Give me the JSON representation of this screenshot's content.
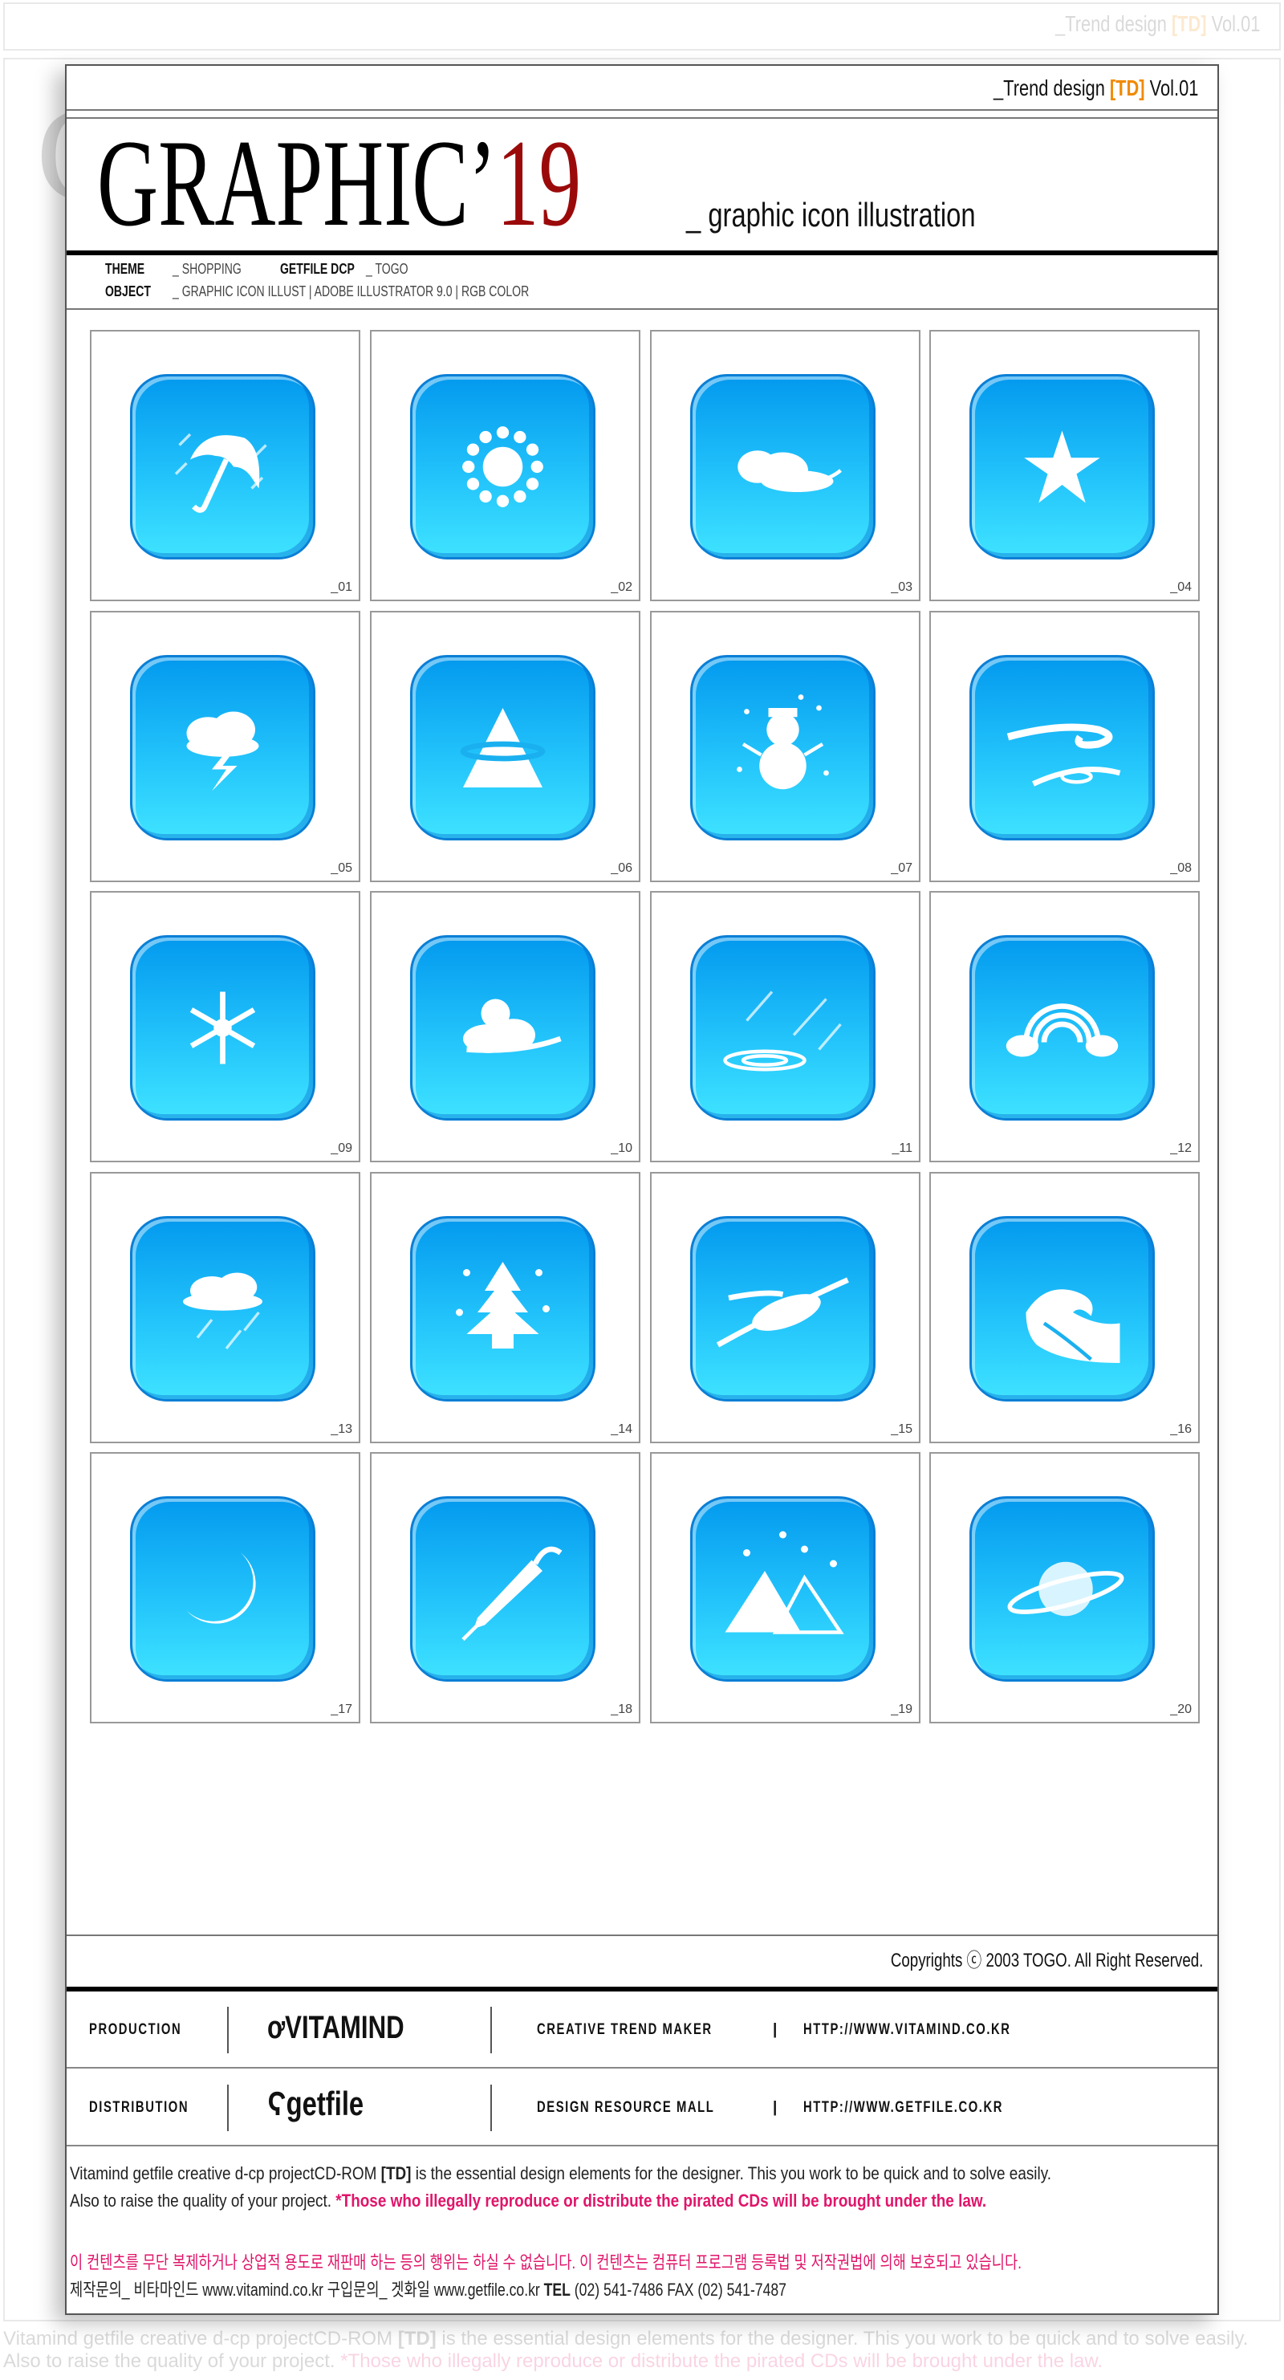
{
  "header": {
    "series": "_Trend design ",
    "badge": "[TD]",
    "volume": " Vol.01",
    "title_main": "GRAPHIC’",
    "title_num": "19",
    "subtitle": "_ graphic icon illustration"
  },
  "meta": {
    "theme_label": "THEME",
    "theme_value": "_ SHOPPING",
    "getfile_label": "GETFILE DCP",
    "getfile_value": "_ TOGO",
    "object_label": "OBJECT",
    "object_value": "_ GRAPHIC ICON ILLUST  |  ADOBE ILLUSTRATOR 9.0  |  RGB COLOR"
  },
  "icons": [
    {
      "num": "_01",
      "icon": "umbrella-rain"
    },
    {
      "num": "_02",
      "icon": "sun"
    },
    {
      "num": "_03",
      "icon": "cloud"
    },
    {
      "num": "_04",
      "icon": "star"
    },
    {
      "num": "_05",
      "icon": "thunder-cloud"
    },
    {
      "num": "_06",
      "icon": "mountain-cloud"
    },
    {
      "num": "_07",
      "icon": "snowman"
    },
    {
      "num": "_08",
      "icon": "wind"
    },
    {
      "num": "_09",
      "icon": "snowflake"
    },
    {
      "num": "_10",
      "icon": "sun-cloud"
    },
    {
      "num": "_11",
      "icon": "rain-puddle"
    },
    {
      "num": "_12",
      "icon": "rainbow"
    },
    {
      "num": "_13",
      "icon": "rain-cloud"
    },
    {
      "num": "_14",
      "icon": "snow-tree"
    },
    {
      "num": "_15",
      "icon": "typhoon"
    },
    {
      "num": "_16",
      "icon": "wave"
    },
    {
      "num": "_17",
      "icon": "moon"
    },
    {
      "num": "_18",
      "icon": "closed-umbrella"
    },
    {
      "num": "_19",
      "icon": "snow-mountain"
    },
    {
      "num": "_20",
      "icon": "planet"
    }
  ],
  "copyright": "Copyrights ⓒ 2003 TOGO. All Right Reserved.",
  "production": {
    "label": "PRODUCTION",
    "brand": "VITAMIND",
    "tagline": "CREATIVE TREND MAKER",
    "sep": "|",
    "url": "HTTP://WWW.VITAMIND.CO.KR"
  },
  "distribution": {
    "label": "DISTRIBUTION",
    "brand": "getfile",
    "tagline": "DESIGN RESOURCE MALL",
    "sep": "|",
    "url": "HTTP://WWW.GETFILE.CO.KR"
  },
  "notice": {
    "line1_a": "Vitamind getfile creative d-cp projectCD-ROM ",
    "line1_badge": "[TD]",
    "line1_b": " is the essential design elements for the designer. This you work to be quick and to solve easily.",
    "line2_a": "Also to raise the quality of your project. ",
    "line2_warn": "*Those who illegally reproduce or distribute the pirated CDs will be brought under the law.",
    "korean_warn": "이 컨텐츠를 무단 복제하거나 상업적 용도로 재판매 하는 등의  행위는 하실 수 없습니다. 이 컨텐츠는 컴퓨터 프로그램 등록법 및 저작권법에 의해 보호되고 있습니다.",
    "contact_a": "제작문의_ 비타마인드 www.vitamind.co.kr   구입문의_ 겟화일 www.getfile.co.kr   ",
    "contact_tel": "TEL",
    "contact_b": " (02) 541-7486  FAX (02) 541-7487"
  },
  "colors": {
    "accent": "#f08a00",
    "title_red": "#9b0a0a",
    "warning": "#e0156a",
    "icon_blue": "#0399ee"
  }
}
